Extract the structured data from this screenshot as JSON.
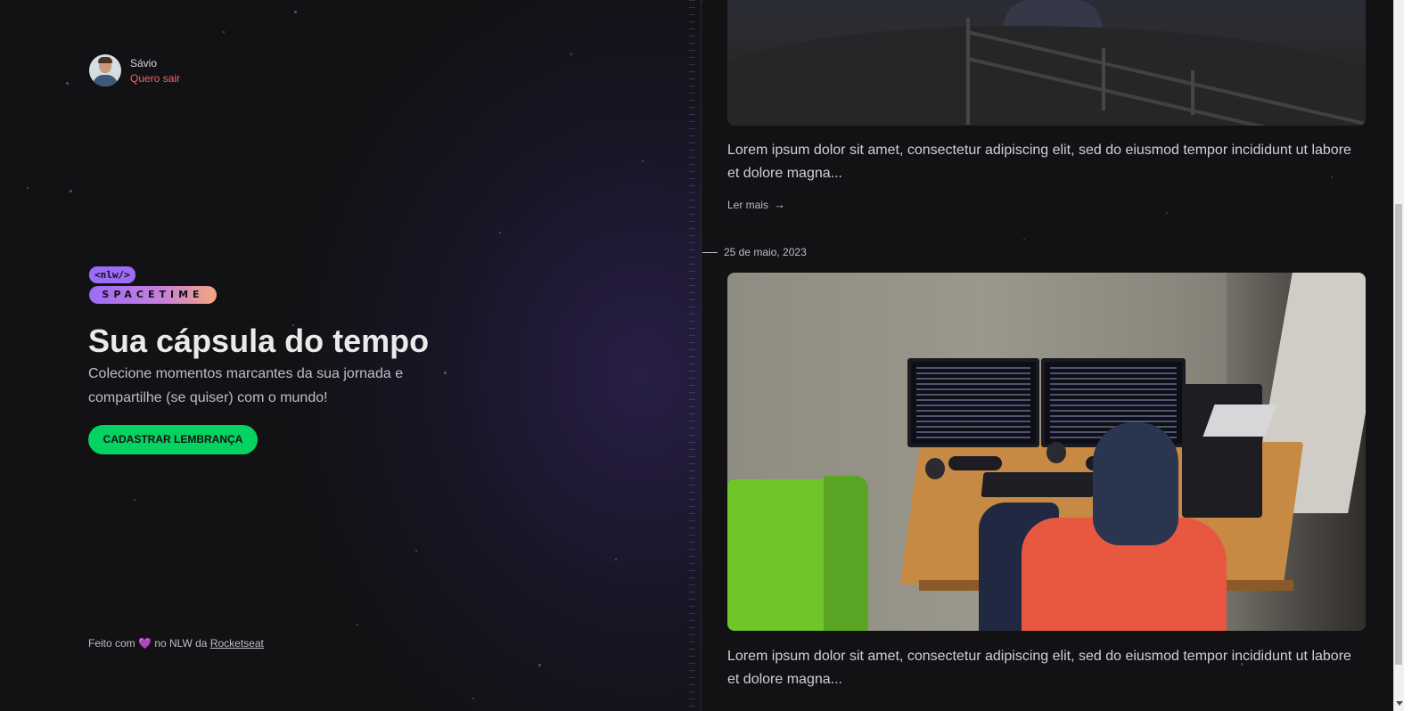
{
  "user": {
    "name": "Sávio",
    "logout_label": "Quero sair"
  },
  "brand": {
    "tag": "<nlw/>",
    "name": "SPACETIME"
  },
  "hero": {
    "title": "Sua cápsula do tempo",
    "subtitle": "Colecione momentos marcantes da sua jornada e compartilhe (se quiser) com o mundo!",
    "cta_label": "CADASTRAR LEMBRANÇA"
  },
  "footer": {
    "prefix": "Feito com",
    "heart": "💜",
    "middle": "no NLW da",
    "link": "Rocketseat"
  },
  "memories": [
    {
      "date": "",
      "excerpt": "Lorem ipsum dolor sit amet, consectetur adipiscing elit, sed do eiusmod tempor incididunt ut labore et dolore magna...",
      "read_more": "Ler mais"
    },
    {
      "date": "25 de maio, 2023",
      "excerpt": "Lorem ipsum dolor sit amet, consectetur adipiscing elit, sed do eiusmod tempor incididunt ut labore et dolore magna..."
    }
  ],
  "colors": {
    "background": "#121215",
    "accent_green": "#04d361",
    "accent_purple": "#9b6cf5",
    "logout_red": "#f56565"
  },
  "icons": {
    "read_more": "arrow-right-icon"
  }
}
